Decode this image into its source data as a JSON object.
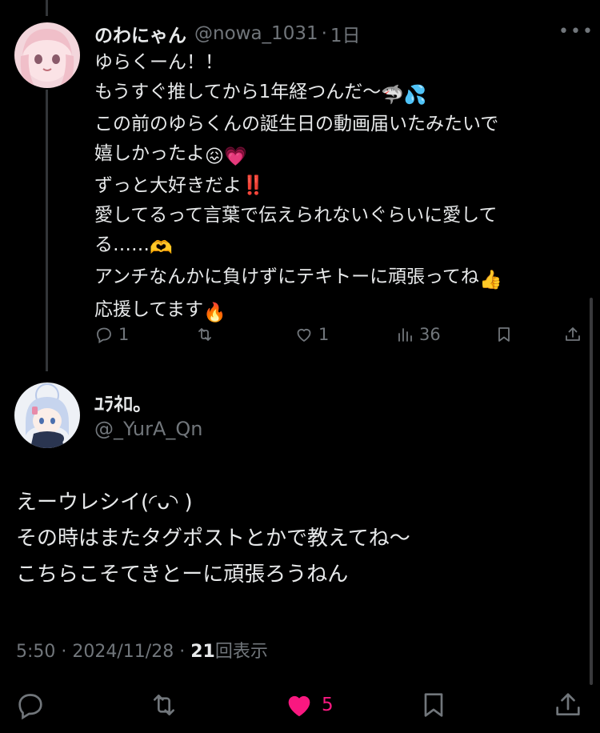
{
  "reply": {
    "name": "のわにゃん",
    "handle": "@nowa_1031",
    "separator": "·",
    "time": "1日",
    "more_icon": "more-icon",
    "lines": [
      "ゆらくーん！！",
      "もうすぐ推してから1年経つんだ〜",
      "この前のゆらくんの誕生日の動画届いたみたいで",
      "嬉しかったよ",
      "ずっと大好きだよ",
      "愛してるって言葉で伝えられないぐらいに愛して",
      "る……",
      "アンチなんかに負けずにテキトーに頑張ってね",
      "応援してます"
    ],
    "emoji": {
      "line2_shark": "🦈",
      "line2_sweat": "💦",
      "line4_face": "😖",
      "line4_heart": "💗",
      "line5_bang": "‼️",
      "line7_hands": "🫶",
      "line8_thumb": "👍",
      "line9_fire": "🔥"
    },
    "actions": {
      "replies": "1",
      "reposts": "",
      "likes": "1",
      "views": "36"
    }
  },
  "post": {
    "author_name": "ﾕﾗﾈﾛ。",
    "author_handle": "@_YurA_Qn",
    "lines": [
      "えーウレシイ(◜ᴗ◝ )",
      "その時はまたタグポストとかで教えてね〜",
      "こちらこそてきとーに頑張ろうねん"
    ],
    "meta": {
      "time": "5:50",
      "sep": "·",
      "date": "2024/11/28",
      "sep2": "·",
      "views_count": "21",
      "views_label": "回表示"
    },
    "actions": {
      "like_count": "5"
    }
  },
  "colors": {
    "background": "#000000",
    "text": "#e7e9ea",
    "muted": "#71767b",
    "like": "#f91880",
    "thread_line": "#333639"
  }
}
